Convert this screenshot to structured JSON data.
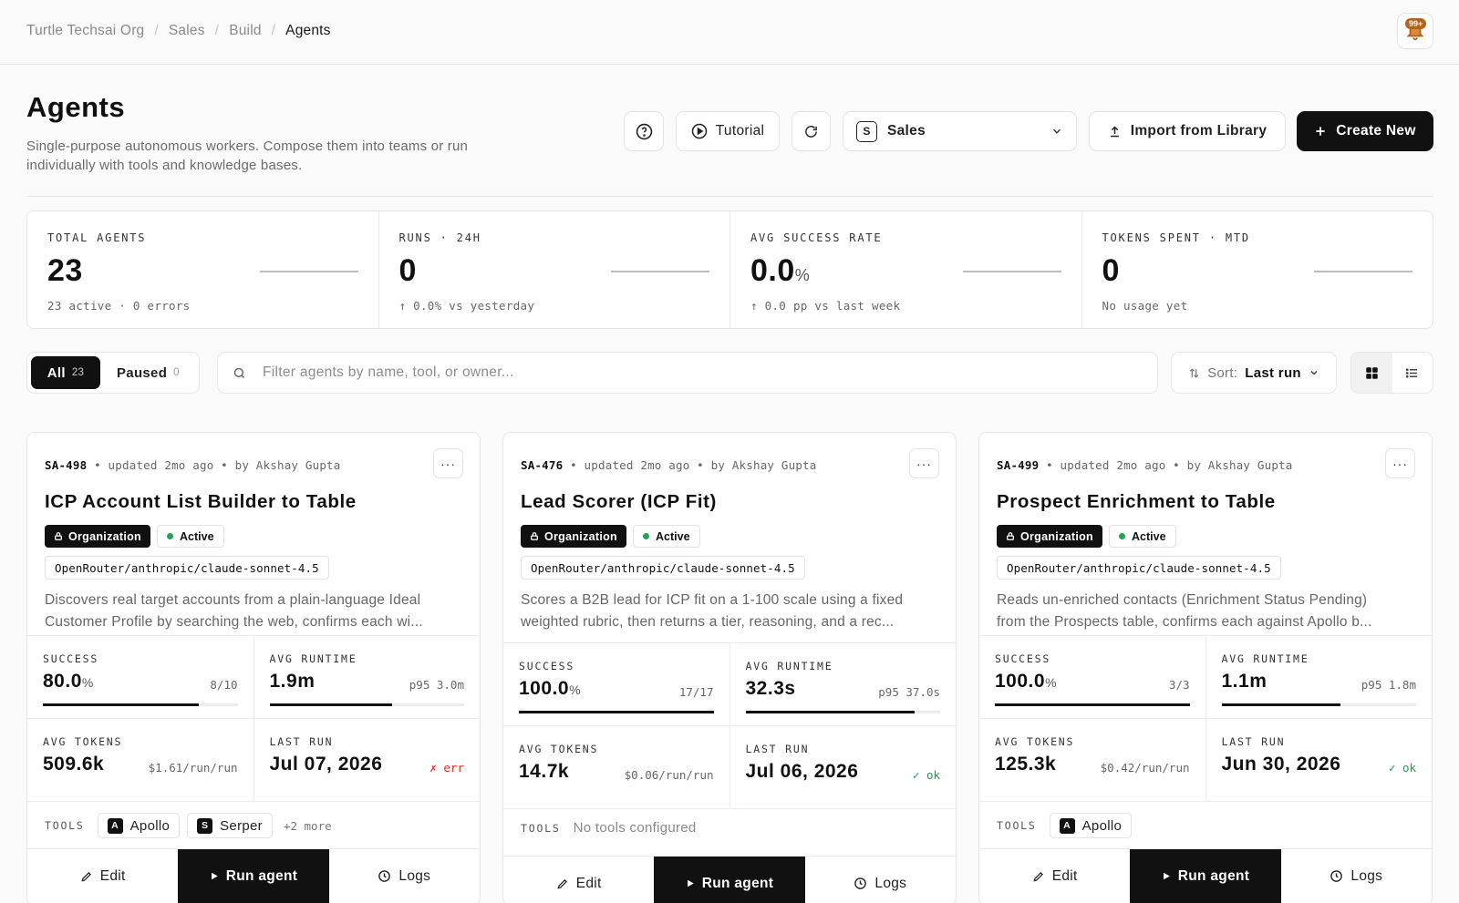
{
  "breadcrumb": [
    "Turtle Techsai Org",
    "Sales",
    "Build",
    "Agents"
  ],
  "notifications": {
    "badge": "99+"
  },
  "header": {
    "title": "Agents",
    "subtitle_line1": "Single-purpose autonomous workers. Compose them into teams or run",
    "subtitle_line2": "individually with tools and knowledge bases.",
    "tutorial_label": "Tutorial",
    "team_initial": "S",
    "team_name": "Sales",
    "import_label": "Import from Library",
    "create_label": "Create New"
  },
  "stats": [
    {
      "label": "TOTAL AGENTS",
      "value": "23",
      "unit": "",
      "foot": "23 active · 0 errors"
    },
    {
      "label": "RUNS · 24H",
      "value": "0",
      "unit": "",
      "foot": "↑ 0.0% vs yesterday"
    },
    {
      "label": "AVG SUCCESS RATE",
      "value": "0.0",
      "unit": "%",
      "foot": "↑ 0.0 pp vs last week"
    },
    {
      "label": "TOKENS SPENT · MTD",
      "value": "0",
      "unit": "",
      "foot": "No usage yet"
    }
  ],
  "filters": {
    "all_label": "All",
    "all_count": "23",
    "paused_label": "Paused",
    "paused_count": "0",
    "search_placeholder": "Filter agents by name, tool, or owner...",
    "sort_prefix": "Sort:",
    "sort_value": "Last run"
  },
  "labels": {
    "success": "SUCCESS",
    "avg_runtime": "AVG RUNTIME",
    "avg_tokens": "AVG TOKENS",
    "last_run": "LAST RUN",
    "tools": "TOOLS",
    "org": "Organization",
    "active": "Active",
    "edit": "Edit",
    "run": "Run agent",
    "logs": "Logs"
  },
  "cards": [
    {
      "id": "SA-498",
      "updated": "updated 2mo ago",
      "owner": "by Akshay Gupta",
      "name": "ICP Account List Builder to Table",
      "model": "OpenRouter/anthropic/claude-sonnet-4.5",
      "desc1": "Discovers real target accounts from a plain-language Ideal",
      "desc2": "Customer Profile by searching the web, confirms each wi...",
      "success": "80.0",
      "success_unit": "%",
      "success_ratio": "8/10",
      "success_fill": 0.8,
      "runtime": "1.9m",
      "runtime_p95": "p95 3.0m",
      "runtime_fill": 0.63,
      "tokens": "509.6k",
      "cost": "$1.61/run/run",
      "last_run": "Jul 07, 2026",
      "status": "✗ err",
      "status_kind": "err",
      "tools": [
        {
          "icon": "A",
          "name": "Apollo"
        },
        {
          "icon": "S",
          "name": "Serper"
        }
      ],
      "tools_more": "+2 more"
    },
    {
      "id": "SA-476",
      "updated": "updated 2mo ago",
      "owner": "by Akshay Gupta",
      "name": "Lead Scorer (ICP Fit)",
      "model": "OpenRouter/anthropic/claude-sonnet-4.5",
      "desc1": "Scores a B2B lead for ICP fit on a 1-100 scale using a fixed",
      "desc2": "weighted rubric, then returns a tier, reasoning, and a rec...",
      "success": "100.0",
      "success_unit": "%",
      "success_ratio": "17/17",
      "success_fill": 1.0,
      "runtime": "32.3s",
      "runtime_p95": "p95 37.0s",
      "runtime_fill": 0.87,
      "tokens": "14.7k",
      "cost": "$0.06/run/run",
      "last_run": "Jul 06, 2026",
      "status": "✓ ok",
      "status_kind": "ok",
      "tools": [],
      "tools_none": "No tools configured",
      "tools_more": ""
    },
    {
      "id": "SA-499",
      "updated": "updated 2mo ago",
      "owner": "by Akshay Gupta",
      "name": "Prospect Enrichment to Table",
      "model": "OpenRouter/anthropic/claude-sonnet-4.5",
      "desc1": "Reads un-enriched contacts (Enrichment Status Pending)",
      "desc2": "from the Prospects table, confirms each against Apollo b...",
      "success": "100.0",
      "success_unit": "%",
      "success_ratio": "3/3",
      "success_fill": 1.0,
      "runtime": "1.1m",
      "runtime_p95": "p95 1.8m",
      "runtime_fill": 0.61,
      "tokens": "125.3k",
      "cost": "$0.42/run/run",
      "last_run": "Jun 30, 2026",
      "status": "✓ ok",
      "status_kind": "ok",
      "tools": [
        {
          "icon": "A",
          "name": "Apollo"
        }
      ],
      "tools_more": ""
    }
  ]
}
